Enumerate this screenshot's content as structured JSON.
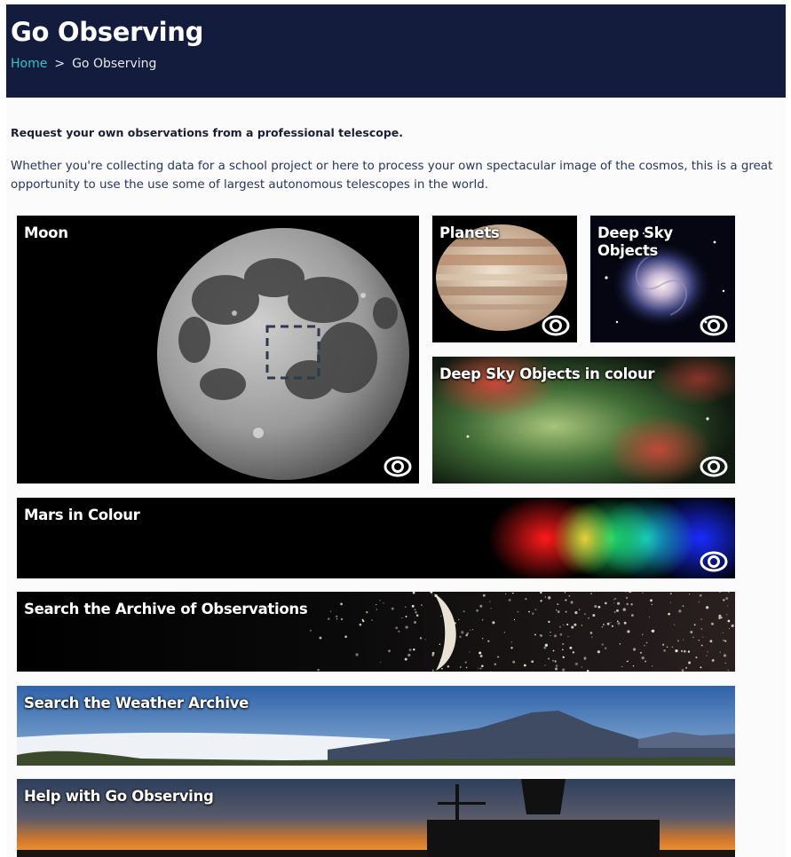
{
  "header": {
    "title": "Go Observing",
    "breadcrumb": {
      "home": "Home",
      "separator": ">",
      "current": "Go Observing"
    }
  },
  "intro": {
    "lead": "Request your own observations from a professional telescope.",
    "text": "Whether you're collecting data for a school project or here to process your own spectacular image of the cosmos, this is a great opportunity to use the use some of largest autonomous telescopes in the world."
  },
  "tiles": {
    "moon": {
      "title": "Moon",
      "icon": "eye-icon"
    },
    "planets": {
      "title": "Planets",
      "icon": "eye-icon"
    },
    "deep_sky": {
      "title_line1": "Deep Sky",
      "title_line2": "Objects",
      "icon": "eye-icon"
    },
    "deep_sky_colour": {
      "title": "Deep Sky Objects in colour",
      "icon": "eye-icon"
    },
    "mars": {
      "title": "Mars in Colour",
      "icon": "eye-icon"
    },
    "archive": {
      "title": "Search the Archive of Observations"
    },
    "weather": {
      "title": "Search the Weather Archive"
    },
    "help": {
      "title": "Help with Go Observing"
    }
  },
  "colors": {
    "header_bg": "#141c3d",
    "breadcrumb_link": "#2fc4c8",
    "body_text": "#27355e",
    "page_bg": "#fbfbfc"
  }
}
